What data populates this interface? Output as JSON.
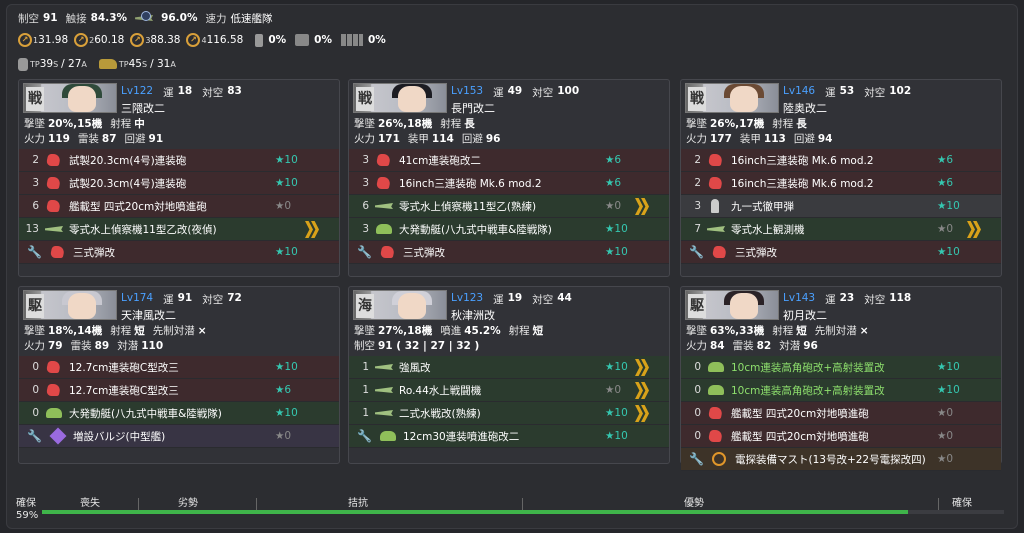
{
  "fleet": {
    "air_label": "制空",
    "air": "91",
    "los_label": "触接",
    "los": "84.3%",
    "contact": "96.0%",
    "speed_label": "速力",
    "speed": "低速艦隊",
    "los_values": [
      "131.98",
      "260.18",
      "388.38",
      "4116.58"
    ],
    "los_icons": [
      {
        "n": "1",
        "v": "31.98"
      },
      {
        "n": "2",
        "v": "60.18"
      },
      {
        "n": "3",
        "v": "88.38"
      },
      {
        "n": "4",
        "v": "116.58"
      }
    ],
    "supply": [
      "0%",
      "0%",
      "0%"
    ],
    "tp_drum": "39",
    "tp_drum_s": "S",
    "tp_drum_sep": "/ 27",
    "tp_drum_a": "A",
    "tp_tank": "45",
    "tp_tank_s": "S",
    "tp_tank_sep": "/ 31",
    "tp_tank_a": "A",
    "tp_prefix": "TP"
  },
  "ships": [
    {
      "kanji": "戦",
      "lv": "Lv122",
      "luck_l": "運",
      "luck": "18",
      "aa_l": "対空",
      "aa": "83",
      "name": "三隈改二",
      "hair": "#2f4a3a",
      "stat1": [
        [
          "撃墜",
          "20%,15機"
        ],
        [
          "射程",
          "中"
        ]
      ],
      "stat2": [
        [
          "火力",
          "119"
        ],
        [
          "雷装",
          "87"
        ],
        [
          "回避",
          "91"
        ]
      ],
      "slots": [
        {
          "c": "2",
          "t": "red",
          "i": "red",
          "n": "試製20.3cm(4号)連装砲",
          "s": "★10",
          "st": "t",
          "ch": false
        },
        {
          "c": "3",
          "t": "red",
          "i": "red",
          "n": "試製20.3cm(4号)連装砲",
          "s": "★10",
          "st": "t",
          "ch": false
        },
        {
          "c": "6",
          "t": "red",
          "i": "red",
          "n": "艦載型 四式20cm対地噴進砲",
          "s": "★0",
          "st": "g",
          "ch": false
        },
        {
          "c": "13",
          "t": "green",
          "i": "plane",
          "n": "零式水上偵察機11型乙改(夜偵)",
          "s": "",
          "st": "t",
          "ch": true
        },
        {
          "c": "",
          "t": "red",
          "i": "red",
          "n": "三式弾改",
          "s": "★10",
          "st": "t",
          "ch": false,
          "w": true
        }
      ]
    },
    {
      "kanji": "戦",
      "lv": "Lv153",
      "luck_l": "運",
      "luck": "49",
      "aa_l": "対空",
      "aa": "100",
      "name": "長門改二",
      "hair": "#1c1c22",
      "stat1": [
        [
          "撃墜",
          "26%,18機"
        ],
        [
          "射程",
          "長"
        ]
      ],
      "stat2": [
        [
          "火力",
          "171"
        ],
        [
          "装甲",
          "114"
        ],
        [
          "回避",
          "96"
        ]
      ],
      "slots": [
        {
          "c": "3",
          "t": "red",
          "i": "red",
          "n": "41cm連装砲改二",
          "s": "★6",
          "st": "t",
          "ch": false
        },
        {
          "c": "3",
          "t": "red",
          "i": "red",
          "n": "16inch三連装砲 Mk.6 mod.2",
          "s": "★6",
          "st": "t",
          "ch": false
        },
        {
          "c": "6",
          "t": "green",
          "i": "plane",
          "n": "零式水上偵察機11型乙(熟練)",
          "s": "★0",
          "st": "g",
          "ch": true
        },
        {
          "c": "3",
          "t": "green",
          "i": "grn",
          "n": "大発動艇(八九式中戦車&陸戦隊)",
          "s": "★10",
          "st": "t",
          "ch": false
        },
        {
          "c": "",
          "t": "red",
          "i": "red",
          "n": "三式弾改",
          "s": "★10",
          "st": "t",
          "ch": false,
          "w": true
        }
      ]
    },
    {
      "kanji": "戦",
      "lv": "Lv146",
      "luck_l": "運",
      "luck": "53",
      "aa_l": "対空",
      "aa": "102",
      "name": "陸奥改二",
      "hair": "#6b4a34",
      "stat1": [
        [
          "撃墜",
          "26%,17機"
        ],
        [
          "射程",
          "長"
        ]
      ],
      "stat2": [
        [
          "火力",
          "177"
        ],
        [
          "装甲",
          "113"
        ],
        [
          "回避",
          "94"
        ]
      ],
      "slots": [
        {
          "c": "2",
          "t": "red",
          "i": "red",
          "n": "16inch三連装砲 Mk.6 mod.2",
          "s": "★6",
          "st": "t",
          "ch": false
        },
        {
          "c": "2",
          "t": "red",
          "i": "red",
          "n": "16inch三連装砲 Mk.6 mod.2",
          "s": "★6",
          "st": "t",
          "ch": false
        },
        {
          "c": "3",
          "t": "gray",
          "i": "gry",
          "n": "九一式徹甲弾",
          "s": "★10",
          "st": "t",
          "ch": false
        },
        {
          "c": "7",
          "t": "green",
          "i": "plane",
          "n": "零式水上観測機",
          "s": "★0",
          "st": "g",
          "ch": true
        },
        {
          "c": "",
          "t": "red",
          "i": "red",
          "n": "三式弾改",
          "s": "★10",
          "st": "t",
          "ch": false,
          "w": true
        }
      ]
    },
    {
      "kanji": "駆",
      "lv": "Lv174",
      "luck_l": "運",
      "luck": "91",
      "aa_l": "対空",
      "aa": "72",
      "name": "天津風改二",
      "hair": "#c8c8d0",
      "stat1": [
        [
          "撃墜",
          "18%,14機"
        ],
        [
          "射程",
          "短"
        ],
        [
          "先制対潜",
          "×"
        ]
      ],
      "stat2": [
        [
          "火力",
          "79"
        ],
        [
          "雷装",
          "89"
        ],
        [
          "対潜",
          "110"
        ]
      ],
      "slots": [
        {
          "c": "0",
          "t": "red",
          "i": "red",
          "n": "12.7cm連装砲C型改三",
          "s": "★10",
          "st": "t",
          "ch": false
        },
        {
          "c": "0",
          "t": "red",
          "i": "red",
          "n": "12.7cm連装砲C型改三",
          "s": "★6",
          "st": "t",
          "ch": false
        },
        {
          "c": "0",
          "t": "green",
          "i": "grn",
          "n": "大発動艇(八九式中戦車&陸戦隊)",
          "s": "★10",
          "st": "t",
          "ch": false
        },
        {
          "c": "",
          "t": "purple",
          "i": "pur",
          "n": "増設バルジ(中型艦)",
          "s": "★0",
          "st": "g",
          "ch": false,
          "w": true
        }
      ]
    },
    {
      "kanji": "海",
      "lv": "Lv123",
      "luck_l": "運",
      "luck": "19",
      "aa_l": "対空",
      "aa": "44",
      "name": "秋津洲改",
      "hair": "#d0d0d8",
      "stat1": [
        [
          "撃墜",
          "27%,18機"
        ],
        [
          "噴進",
          "45.2%"
        ],
        [
          "射程",
          "短"
        ]
      ],
      "stat2": [
        [
          "制空",
          "91 ( 32 | 27 | 32 )"
        ]
      ],
      "slots": [
        {
          "c": "1",
          "t": "green",
          "i": "plane",
          "n": "強風改",
          "s": "★10",
          "st": "t",
          "ch": true
        },
        {
          "c": "1",
          "t": "green",
          "i": "plane",
          "n": "Ro.44水上戦闘機",
          "s": "★0",
          "st": "g",
          "ch": true
        },
        {
          "c": "1",
          "t": "green",
          "i": "plane",
          "n": "二式水戦改(熟練)",
          "s": "★10",
          "st": "t",
          "ch": true
        },
        {
          "c": "",
          "t": "green",
          "i": "grn",
          "n": "12cm30連装噴進砲改二",
          "s": "★10",
          "st": "t",
          "ch": false,
          "w": true
        }
      ]
    },
    {
      "kanji": "駆",
      "lv": "Lv143",
      "luck_l": "運",
      "luck": "23",
      "aa_l": "対空",
      "aa": "118",
      "name": "初月改二",
      "hair": "#2a2226",
      "stat1": [
        [
          "撃墜",
          "63%,33機"
        ],
        [
          "射程",
          "短"
        ],
        [
          "先制対潜",
          "×"
        ]
      ],
      "stat2": [
        [
          "火力",
          "84"
        ],
        [
          "雷装",
          "82"
        ],
        [
          "対潜",
          "96"
        ]
      ],
      "slots": [
        {
          "c": "0",
          "t": "green",
          "i": "grn",
          "n": "10cm連装高角砲改+高射装置改",
          "s": "★10",
          "st": "t",
          "ch": false,
          "g": true
        },
        {
          "c": "0",
          "t": "green",
          "i": "grn",
          "n": "10cm連装高角砲改+高射装置改",
          "s": "★10",
          "st": "t",
          "ch": false,
          "g": true
        },
        {
          "c": "0",
          "t": "red",
          "i": "red",
          "n": "艦載型 四式20cm対地噴進砲",
          "s": "★0",
          "st": "g",
          "ch": false
        },
        {
          "c": "0",
          "t": "red",
          "i": "red",
          "n": "艦載型 四式20cm対地噴進砲",
          "s": "★0",
          "st": "g",
          "ch": false
        },
        {
          "c": "",
          "t": "orange",
          "i": "org",
          "n": "電探装備マスト(13号改+22号電探改四)",
          "s": "★0",
          "st": "g",
          "ch": false,
          "w": true
        }
      ]
    }
  ],
  "airbar": {
    "left_label": "確保",
    "percent": "59%",
    "fill": 0.9,
    "labels": [
      "喪失",
      "劣勢",
      "拮抗",
      "優勢",
      "確保"
    ]
  }
}
